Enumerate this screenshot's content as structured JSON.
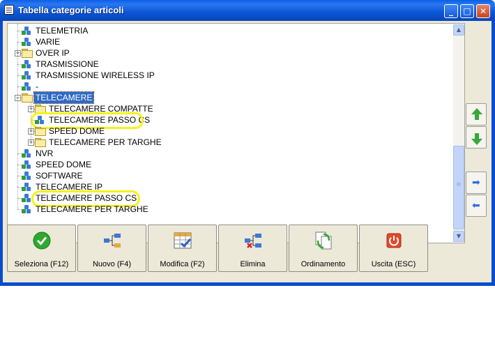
{
  "window": {
    "title": "Tabella categorie articoli",
    "controls": {
      "minimize": "_",
      "maximize": "□",
      "close": "✕"
    }
  },
  "tree": {
    "items": [
      {
        "label": "TELEMETRIA",
        "icon": "category-icon",
        "level": 0
      },
      {
        "label": "VARIE",
        "icon": "category-icon",
        "level": 0
      },
      {
        "label": "OVER IP",
        "icon": "folder-icon",
        "level": 0,
        "expander": "+"
      },
      {
        "label": "TRASMISSIONE",
        "icon": "category-icon",
        "level": 0
      },
      {
        "label": "TRASMISSIONE WIRELESS IP",
        "icon": "category-icon",
        "level": 0
      },
      {
        "label": "-",
        "icon": "category-icon",
        "level": 0
      },
      {
        "label": "TELECAMERE",
        "icon": "folder-icon",
        "level": 0,
        "expander": "−",
        "selected": true
      },
      {
        "label": "TELECAMERE COMPATTE",
        "icon": "folder-icon",
        "level": 1,
        "expander": "+"
      },
      {
        "label": "TELECAMERE PASSO CS",
        "icon": "category-icon",
        "level": 1,
        "highlighted": true
      },
      {
        "label": "SPEED DOME",
        "icon": "folder-icon",
        "level": 1,
        "expander": "+"
      },
      {
        "label": "TELECAMERE PER TARGHE",
        "icon": "folder-icon",
        "level": 1,
        "expander": "+"
      },
      {
        "label": "NVR",
        "icon": "category-icon",
        "level": 0
      },
      {
        "label": "SPEED DOME",
        "icon": "category-icon",
        "level": 0
      },
      {
        "label": "SOFTWARE",
        "icon": "category-icon",
        "level": 0
      },
      {
        "label": "TELECAMERE IP",
        "icon": "category-icon",
        "level": 0
      },
      {
        "label": "TELECAMERE PASSO CS",
        "icon": "category-icon",
        "level": 0,
        "highlighted": true
      },
      {
        "label": "TELECAMERE PER TARGHE",
        "icon": "category-icon",
        "level": 0
      }
    ]
  },
  "side_buttons": {
    "move_up": "green-up-arrow-icon",
    "move_down": "green-down-arrow-icon",
    "indent": "blue-right-arrow-icon",
    "outdent": "blue-left-arrow-icon"
  },
  "toolbar": {
    "select_label": "Seleziona (F12)",
    "new_label": "Nuovo (F4)",
    "edit_label": "Modifica (F2)",
    "delete_label": "Elimina",
    "sort_label": "Ordinamento",
    "exit_label": "Uscita (ESC)"
  },
  "colors": {
    "titlebar": "#0b55d6",
    "selection": "#316ac5",
    "highlight_marker": "#f5f21a"
  }
}
